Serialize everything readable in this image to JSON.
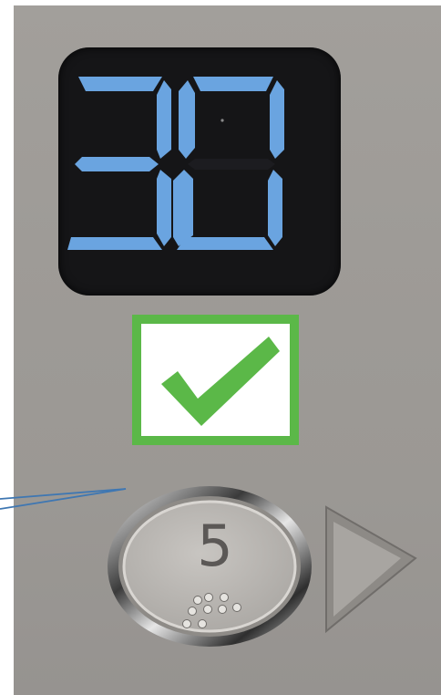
{
  "display": {
    "floor_reading": "30",
    "digit_color": "#6aa4e0",
    "background_color": "#151517"
  },
  "indicator": {
    "icon": "checkmark-icon",
    "border_color": "#5bb848",
    "check_color": "#5bb848"
  },
  "floor_button": {
    "label": "5",
    "braille_icon": "braille-dots-icon",
    "ring_color": "#c9c6c2"
  },
  "direction": {
    "icon": "triangle-right-icon"
  },
  "callout": {
    "line_color": "#3f77b2"
  }
}
